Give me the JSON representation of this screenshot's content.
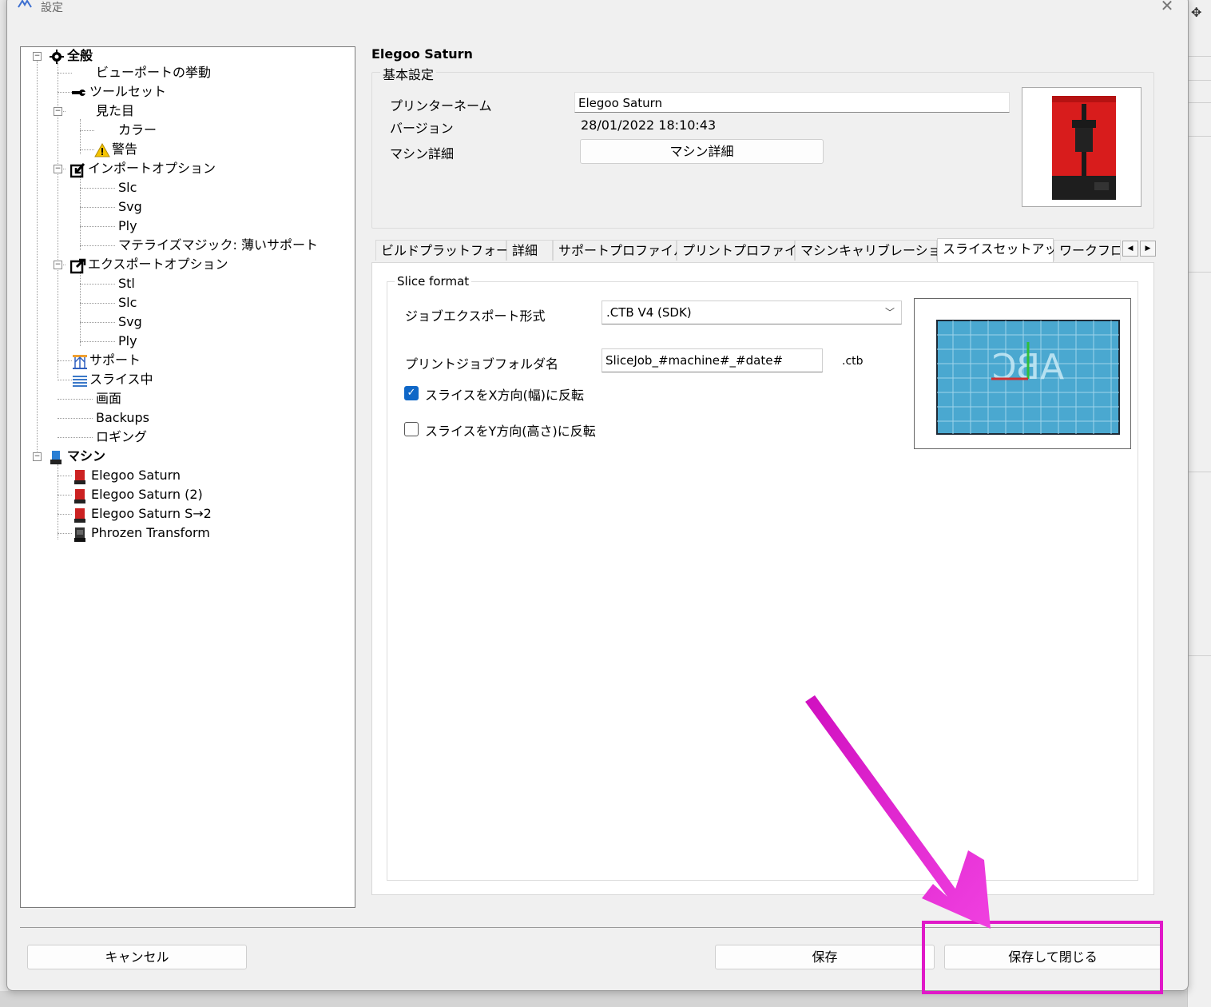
{
  "window": {
    "title": "設定",
    "close_glyph": "✕"
  },
  "tree": {
    "general": "全般",
    "viewport": "ビューポートの挙動",
    "toolset": "ツールセット",
    "appearance": "見た目",
    "color": "カラー",
    "warning": "警告",
    "import_options": "インポートオプション",
    "import_slc": "Slc",
    "import_svg": "Svg",
    "import_ply": "Ply",
    "materialise": "マテライズマジック: 薄いサポート",
    "export_options": "エクスポートオプション",
    "export_stl": "Stl",
    "export_slc": "Slc",
    "export_svg": "Svg",
    "export_ply": "Ply",
    "support": "サポート",
    "slicing": "スライス中",
    "screen": "画面",
    "backups": "Backups",
    "logging": "ロギング",
    "machines": "マシン",
    "machine_list": [
      "Elegoo Saturn",
      "Elegoo Saturn (2)",
      "Elegoo Saturn S→2",
      "Phrozen Transform"
    ]
  },
  "printer": {
    "name": "Elegoo Saturn",
    "basic_settings": "基本設定",
    "name_label": "プリンターネーム",
    "name_value": "Elegoo Saturn",
    "version_label": "バージョン",
    "version_value": "28/01/2022 18:10:43",
    "detail_label": "マシン詳細",
    "detail_button": "マシン詳細"
  },
  "tabs": [
    "ビルドプラットフォーム",
    "詳細",
    "サポートプロファイル",
    "プリントプロファイル",
    "マシンキャリブレーション",
    "スライスセットアップ",
    "ワークフロー"
  ],
  "slice": {
    "group_label": "Slice format",
    "export_format_label": "ジョブエクスポート形式",
    "export_format_value": ".CTB V4 (SDK)",
    "folder_label": "プリントジョブフォルダ名",
    "folder_value": "SliceJob_#machine#_#date#",
    "folder_ext": ".ctb",
    "flip_x_label": "スライスをX方向(幅)に反転",
    "flip_x_checked": true,
    "flip_y_label": "スライスをY方向(高さ)に反転",
    "flip_y_checked": false,
    "preview_text": "ABC"
  },
  "buttons": {
    "cancel": "キャンセル",
    "save": "保存",
    "save_close": "保存して閉じる"
  },
  "colors": {
    "highlight": "#e018c8",
    "checkbox": "#0f67c7",
    "preview_bg": "#4aa8d0"
  }
}
